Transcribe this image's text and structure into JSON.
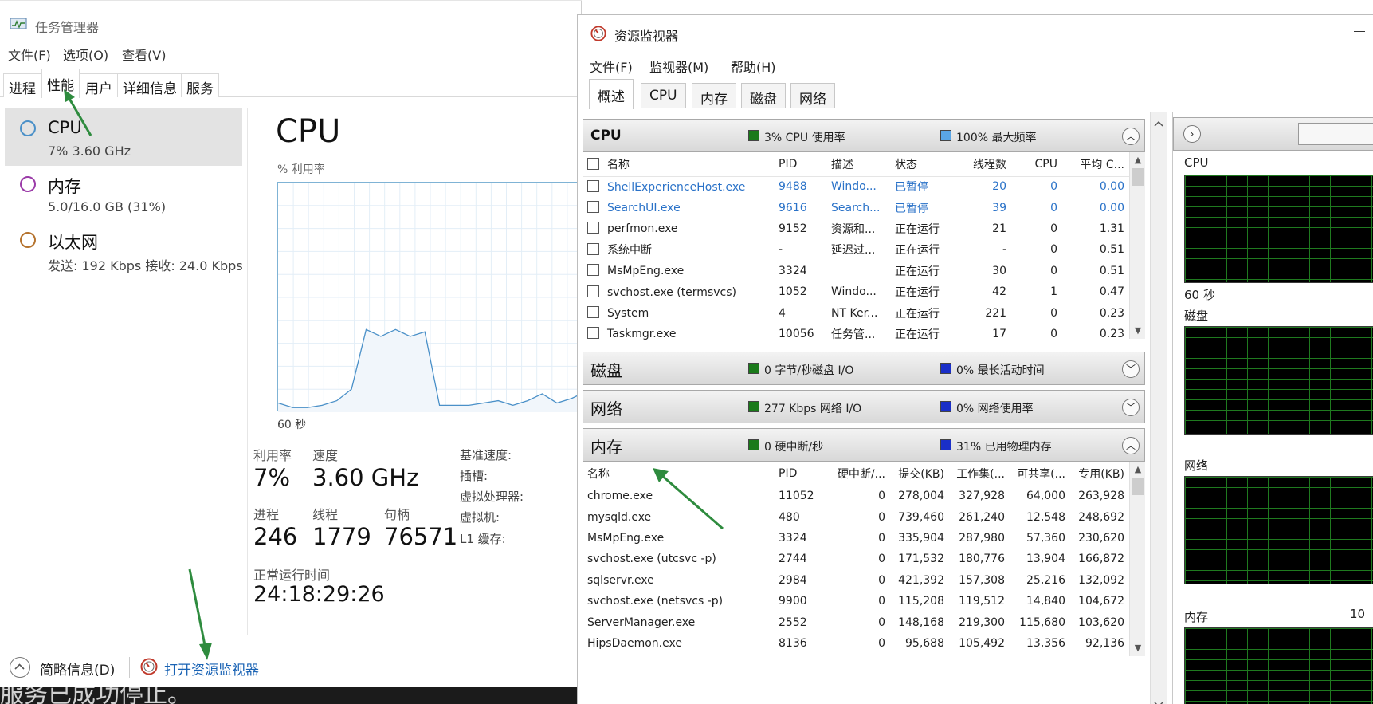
{
  "task_manager": {
    "title": "任务管理器",
    "menu": [
      "文件(F)",
      "选项(O)",
      "查看(V)"
    ],
    "tabs": [
      "进程",
      "性能",
      "用户",
      "详细信息",
      "服务"
    ],
    "active_tab": "性能",
    "sidebar": [
      {
        "name": "CPU",
        "sub": "7% 3.60 GHz",
        "color": "#4a90c8"
      },
      {
        "name": "内存",
        "sub": "5.0/16.0 GB (31%)",
        "color": "#9b3ba8"
      },
      {
        "name": "以太网",
        "sub": "发送: 192 Kbps 接收: 24.0 Kbps",
        "color": "#b5732e"
      }
    ],
    "main": {
      "title": "CPU",
      "utilization_label": "% 利用率",
      "time_span": "60 秒",
      "utilization_label2": "利用率",
      "speed_label": "速度",
      "utilization": "7%",
      "speed": "3.60 GHz",
      "processes_label": "进程",
      "threads_label": "线程",
      "handles_label": "句柄",
      "processes": "246",
      "threads": "1779",
      "handles": "76571",
      "uptime_label": "正常运行时间",
      "uptime": "24:18:29:26",
      "specs": [
        "基准速度:",
        "插槽:",
        "虚拟处理器:",
        "虚拟机:",
        "L1 缓存:"
      ]
    },
    "cpu_history": [
      4,
      2,
      2,
      3,
      5,
      10,
      36,
      33,
      36,
      33,
      35,
      3,
      3,
      3,
      4,
      5,
      3,
      5,
      8,
      4,
      6,
      9,
      6,
      7,
      5
    ],
    "footer": {
      "brief": "简略信息(D)",
      "open_rm": "打开资源监视器"
    },
    "background_text": "服务已成功停止。"
  },
  "resource_monitor": {
    "title": "资源监视器",
    "menu": [
      "文件(F)",
      "监视器(M)",
      "帮助(H)"
    ],
    "tabs": [
      "概述",
      "CPU",
      "内存",
      "磁盘",
      "网络"
    ],
    "active_tab": "概述",
    "cpu_section": {
      "name": "CPU",
      "stat1": "3% CPU 使用率",
      "stat1_color": "#1a7a1a",
      "stat2": "100% 最大频率",
      "stat2_color": "#5aa6e6",
      "columns": [
        "名称",
        "PID",
        "描述",
        "状态",
        "线程数",
        "CPU",
        "平均 C..."
      ],
      "rows": [
        {
          "name": "ShellExperienceHost.exe",
          "pid": "9488",
          "desc": "Windo...",
          "status": "已暂停",
          "threads": "20",
          "cpu": "0",
          "avg": "0.00",
          "suspended": true
        },
        {
          "name": "SearchUI.exe",
          "pid": "9616",
          "desc": "Search...",
          "status": "已暂停",
          "threads": "39",
          "cpu": "0",
          "avg": "0.00",
          "suspended": true
        },
        {
          "name": "perfmon.exe",
          "pid": "9152",
          "desc": "资源和...",
          "status": "正在运行",
          "threads": "21",
          "cpu": "0",
          "avg": "1.31",
          "suspended": false
        },
        {
          "name": "系统中断",
          "pid": "-",
          "desc": "延迟过...",
          "status": "正在运行",
          "threads": "-",
          "cpu": "0",
          "avg": "0.51",
          "suspended": false
        },
        {
          "name": "MsMpEng.exe",
          "pid": "3324",
          "desc": "",
          "status": "正在运行",
          "threads": "30",
          "cpu": "0",
          "avg": "0.51",
          "suspended": false
        },
        {
          "name": "svchost.exe (termsvcs)",
          "pid": "1052",
          "desc": "Windo...",
          "status": "正在运行",
          "threads": "42",
          "cpu": "1",
          "avg": "0.47",
          "suspended": false
        },
        {
          "name": "System",
          "pid": "4",
          "desc": "NT Ker...",
          "status": "正在运行",
          "threads": "221",
          "cpu": "0",
          "avg": "0.23",
          "suspended": false
        },
        {
          "name": "Taskmgr.exe",
          "pid": "10056",
          "desc": "任务管...",
          "status": "正在运行",
          "threads": "17",
          "cpu": "0",
          "avg": "0.23",
          "suspended": false
        }
      ]
    },
    "disk_section": {
      "name": "磁盘",
      "stat1": "0 字节/秒磁盘 I/O",
      "stat1_color": "#1a7a1a",
      "stat2": "0% 最长活动时间",
      "stat2_color": "#1a2fc8"
    },
    "network_section": {
      "name": "网络",
      "stat1": "277 Kbps 网络 I/O",
      "stat1_color": "#1a7a1a",
      "stat2": "0% 网络使用率",
      "stat2_color": "#1a2fc8"
    },
    "memory_section": {
      "name": "内存",
      "stat1": "0 硬中断/秒",
      "stat1_color": "#1a7a1a",
      "stat2": "31% 已用物理内存",
      "stat2_color": "#1a2fc8",
      "columns": [
        "名称",
        "PID",
        "硬中断/...",
        "提交(KB)",
        "工作集(...",
        "可共享(...",
        "专用(KB)"
      ],
      "rows": [
        {
          "name": "chrome.exe",
          "pid": "11052",
          "hard": "0",
          "commit": "278,004",
          "ws": "327,928",
          "share": "64,000",
          "priv": "263,928"
        },
        {
          "name": "mysqld.exe",
          "pid": "480",
          "hard": "0",
          "commit": "739,460",
          "ws": "261,240",
          "share": "12,548",
          "priv": "248,692"
        },
        {
          "name": "MsMpEng.exe",
          "pid": "3324",
          "hard": "0",
          "commit": "335,904",
          "ws": "287,980",
          "share": "57,360",
          "priv": "230,620"
        },
        {
          "name": "svchost.exe (utcsvc -p)",
          "pid": "2744",
          "hard": "0",
          "commit": "171,532",
          "ws": "180,776",
          "share": "13,904",
          "priv": "166,872"
        },
        {
          "name": "sqlservr.exe",
          "pid": "2984",
          "hard": "0",
          "commit": "421,392",
          "ws": "157,308",
          "share": "25,216",
          "priv": "132,092"
        },
        {
          "name": "svchost.exe (netsvcs -p)",
          "pid": "9900",
          "hard": "0",
          "commit": "115,208",
          "ws": "119,512",
          "share": "14,840",
          "priv": "104,672"
        },
        {
          "name": "ServerManager.exe",
          "pid": "2552",
          "hard": "0",
          "commit": "148,168",
          "ws": "219,300",
          "share": "115,680",
          "priv": "103,620"
        },
        {
          "name": "HipsDaemon.exe",
          "pid": "8136",
          "hard": "0",
          "commit": "95,688",
          "ws": "105,492",
          "share": "13,356",
          "priv": "92,136"
        }
      ]
    },
    "right_pane": {
      "cpu_label": "CPU",
      "time_span": "60 秒",
      "disk_label": "磁盘",
      "network_label": "网络",
      "memory_label": "内存",
      "memory_value_partial": "10"
    }
  }
}
